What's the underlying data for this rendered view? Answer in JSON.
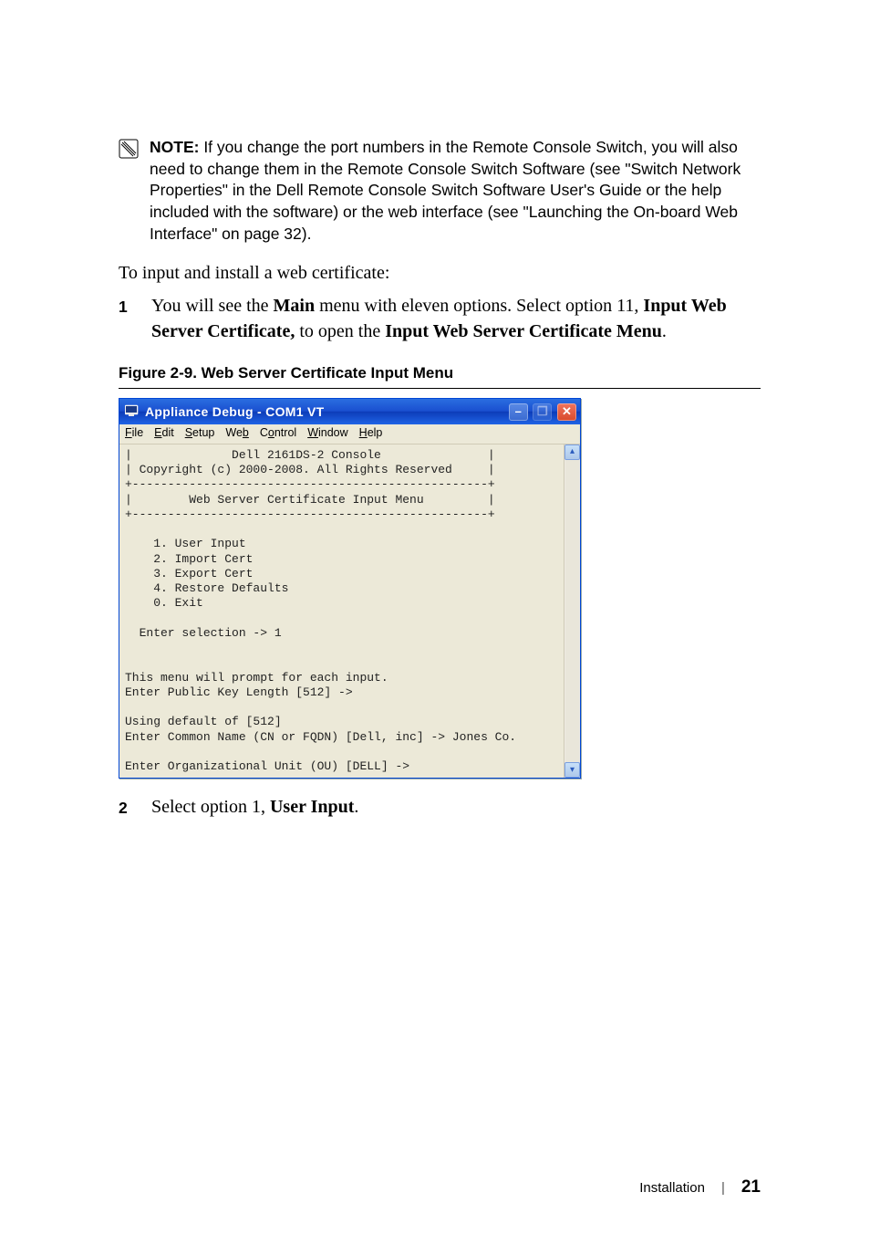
{
  "note": {
    "label": "NOTE:",
    "text": " If you change the port numbers in the Remote Console Switch, you will also need to change them in the Remote Console Switch Software (see \"Switch Network Properties\" in the Dell Remote Console Switch Software User's Guide or the help included with the software) or the web interface (see \"Launching the On-board Web Interface\" on page 32)."
  },
  "intro": "To input and install a web certificate:",
  "step1": {
    "num": "1",
    "pre": "You will see the ",
    "bold1": "Main",
    "mid1": " menu with eleven options. Select option 11, ",
    "bold2": "Input Web Server Certificate,",
    "mid2": " to open the ",
    "bold3": "Input Web Server Certificate Menu",
    "post": "."
  },
  "figure_caption": "Figure 2-9.    Web Server Certificate Input Menu",
  "window": {
    "title": "Appliance Debug - COM1 VT",
    "menubar": {
      "file": "File",
      "edit": "Edit",
      "setup": "Setup",
      "web": "Web",
      "control": "Control",
      "window": "Window",
      "help": "Help"
    },
    "terminal_text": "|              Dell 2161DS-2 Console               |\n| Copyright (c) 2000-2008. All Rights Reserved     |\n+--------------------------------------------------+\n|        Web Server Certificate Input Menu         |\n+--------------------------------------------------+\n\n    1. User Input\n    2. Import Cert\n    3. Export Cert\n    4. Restore Defaults\n    0. Exit\n\n  Enter selection -> 1\n\n\nThis menu will prompt for each input.\nEnter Public Key Length [512] ->\n\nUsing default of [512]\nEnter Common Name (CN or FQDN) [Dell, inc] -> Jones Co.\n\nEnter Organizational Unit (OU) [DELL] ->"
  },
  "step2": {
    "num": "2",
    "pre": "Select option 1, ",
    "bold1": "User Input",
    "post": "."
  },
  "footer": {
    "section": "Installation",
    "page": "21"
  }
}
